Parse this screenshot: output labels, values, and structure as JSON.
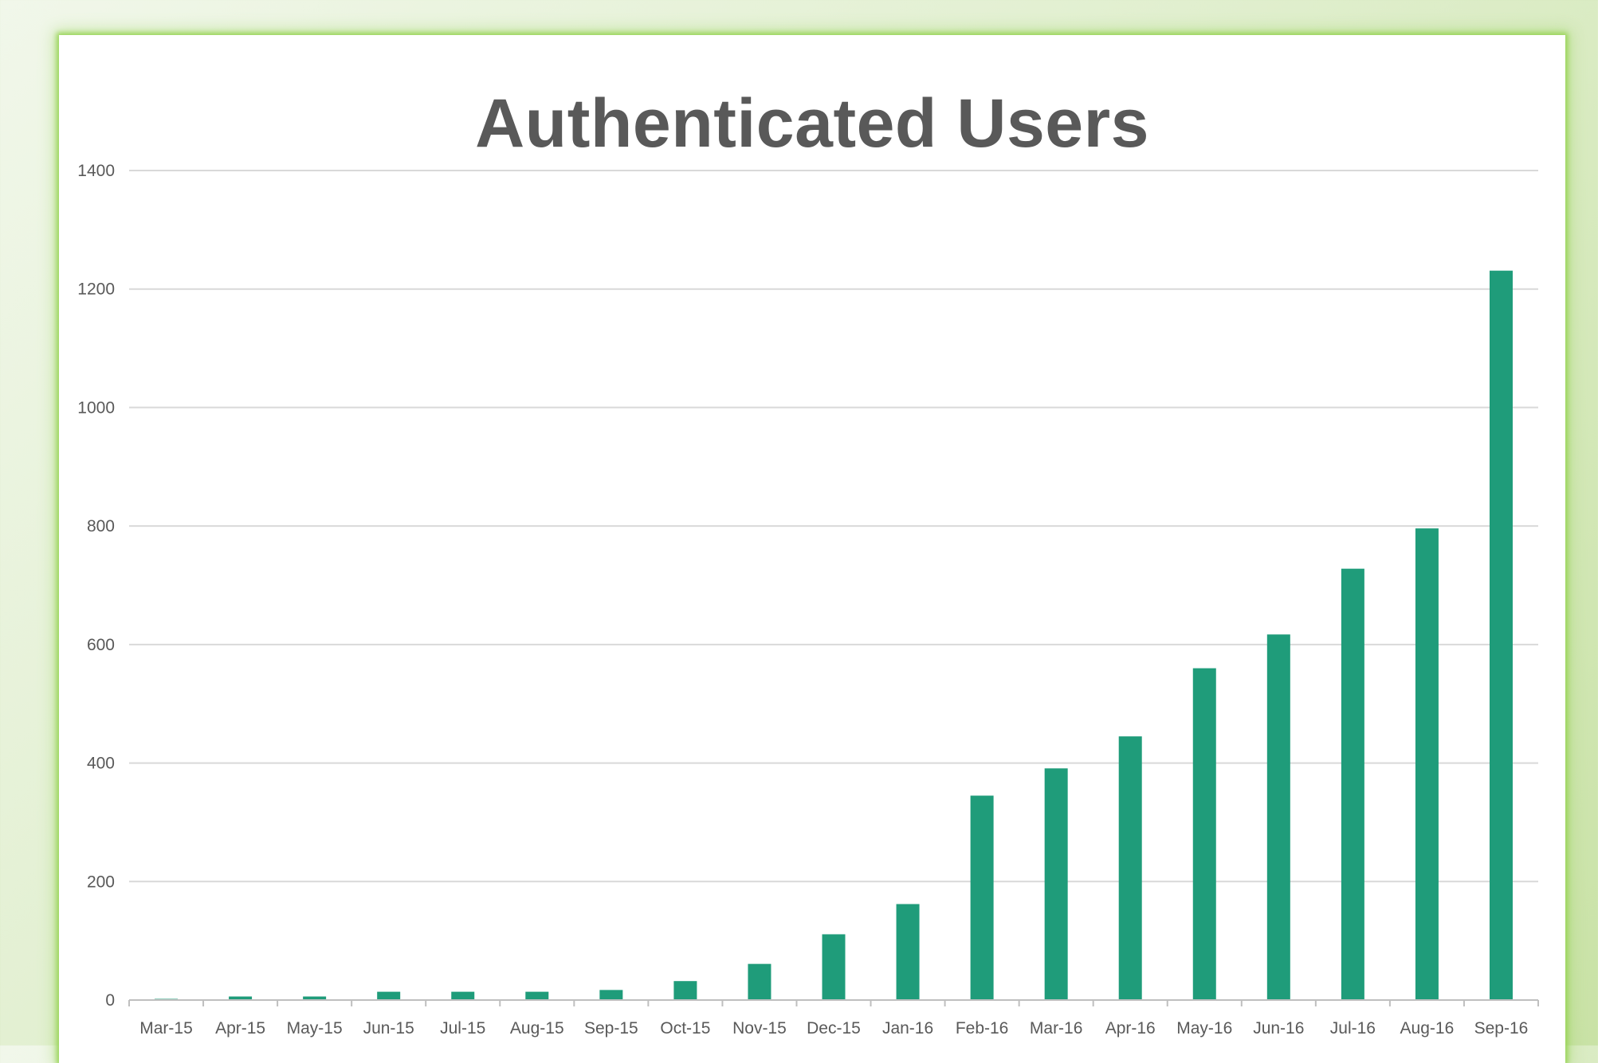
{
  "chart_data": {
    "type": "bar",
    "title": "Authenticated Users",
    "xlabel": "",
    "ylabel": "",
    "ylim": [
      0,
      1400
    ],
    "yticks": [
      0,
      200,
      400,
      600,
      800,
      1000,
      1200,
      1400
    ],
    "grid": true,
    "legend": "none",
    "bar_color": "#1f9c7a",
    "categories": [
      "Mar-15",
      "Apr-15",
      "May-15",
      "Jun-15",
      "Jul-15",
      "Aug-15",
      "Sep-15",
      "Oct-15",
      "Nov-15",
      "Dec-15",
      "Jan-16",
      "Feb-16",
      "Mar-16",
      "Apr-16",
      "May-16",
      "Jun-16",
      "Jul-16",
      "Aug-16",
      "Sep-16"
    ],
    "values": [
      2,
      6,
      6,
      14,
      14,
      14,
      17,
      32,
      61,
      111,
      162,
      345,
      391,
      445,
      560,
      617,
      728,
      796,
      1231
    ]
  }
}
